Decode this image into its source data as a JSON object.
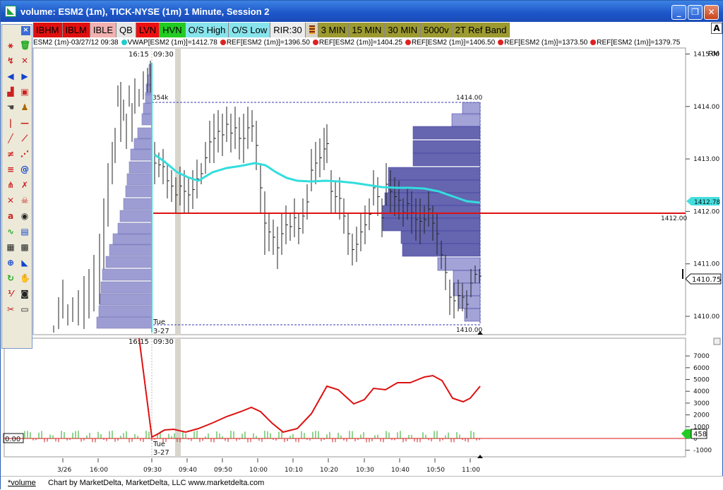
{
  "window": {
    "title": "volume: ESM2 (1m), TICK-NYSE (1m) 1 Minute, Session 2",
    "minimize_label": "_",
    "restore_label": "❐",
    "close_label": "✕"
  },
  "toolbar": {
    "buttons": [
      {
        "label": "IBHM",
        "bg": "#e01010",
        "fg": "#000000"
      },
      {
        "label": "IBLM",
        "bg": "#e01010",
        "fg": "#000000"
      },
      {
        "label": "IBLE",
        "bg": "#f2b0b0",
        "fg": "#000000"
      },
      {
        "label": "QB",
        "bg": "#e6e6e6",
        "fg": "#000000"
      },
      {
        "label": "LVN",
        "bg": "#ee1010",
        "fg": "#000000"
      },
      {
        "label": "HVN",
        "bg": "#22cc22",
        "fg": "#000000"
      },
      {
        "label": "O/S High",
        "bg": "#88e4ec",
        "fg": "#000000"
      },
      {
        "label": "O/S Low",
        "bg": "#88e4ec",
        "fg": "#000000"
      },
      {
        "label": "RIR:30",
        "bg": "#ececec",
        "fg": "#000000"
      },
      {
        "label": "3 MIN",
        "bg": "#9c9a30",
        "fg": "#000000"
      },
      {
        "label": "15 MIN",
        "bg": "#9c9a30",
        "fg": "#000000"
      },
      {
        "label": "30 MIN",
        "bg": "#9c9a30",
        "fg": "#000000"
      },
      {
        "label": "5000v",
        "bg": "#9c9a30",
        "fg": "#000000"
      },
      {
        "label": "2T Ref Band",
        "bg": "#9c9a30",
        "fg": "#000000"
      }
    ],
    "a_label": "A"
  },
  "legend": [
    {
      "text": "ESM2 (1m)-03/27/12 09:38",
      "dot": ""
    },
    {
      "text": "VWAP[ESM2 (1m)]=1412.78",
      "dot": "cyan"
    },
    {
      "text": "REF[ESM2 (1m)]=1396.50",
      "dot": "red"
    },
    {
      "text": "REF[ESM2 (1m)]=1404.25",
      "dot": "red"
    },
    {
      "text": "REF[ESM2 (1m)]=1406.50",
      "dot": "red"
    },
    {
      "text": "REF[ESM2 (1m)]=1373.50",
      "dot": "red"
    },
    {
      "text": "REF[ESM2 (1m)]=1379.75",
      "dot": "red"
    }
  ],
  "price_pane": {
    "rm_label": "RM",
    "session_labels": {
      "prev_close": "16:15",
      "open": "09:30",
      "day": "Tue",
      "date": "3-27"
    },
    "volume_label": "354k",
    "range_high_label": "1414.00",
    "range_low_label": "1410.00",
    "ref_line_label": "1412.00",
    "vwap_tag": "1412.78",
    "last_price_tag": "1410.75",
    "price_axis": [
      "1415.00",
      "1414.00",
      "1413.00",
      "1412.00",
      "1411.00",
      "1410.00"
    ]
  },
  "tick_pane": {
    "session_labels": {
      "prev_close": "16:15",
      "open": "09:30",
      "day": "Tue",
      "date": "3-27"
    },
    "zero_label": "0.00",
    "last_tag": "458",
    "axis": [
      "7000",
      "6000",
      "5000",
      "4000",
      "3000",
      "2000",
      "1000",
      "0",
      "-1000"
    ]
  },
  "time_axis": [
    "3/26",
    "16:00",
    "09:30",
    "09:40",
    "09:50",
    "10:00",
    "10:10",
    "10:20",
    "10:30",
    "10:40",
    "10:50",
    "11:00"
  ],
  "status": {
    "tab_label": "*volume",
    "credit": "Chart by MarketDelta, MarketDelta, LLC www.marketdelta.com"
  },
  "palette_icons": [
    "xyz-zoom-icon",
    "trash-icon",
    "xyz-cursor-icon",
    "xyz-arrow-icon",
    "left-arrow-icon",
    "right-arrow-icon",
    "chart-bars-icon",
    "chart-window-icon",
    "hand-cursor-icon",
    "bell-icon",
    "vertical-line-icon",
    "horizontal-line-icon",
    "trendline-icon",
    "ray-icon",
    "parallel-lines-icon",
    "fan-icon",
    "fibonacci-icon",
    "spiral-icon",
    "andrews-pitchfork-icon",
    "gann-icon",
    "cross-icon",
    "skull-icon",
    "text-a-icon",
    "circle-square-icon",
    "wave-icon",
    "ibm-icon",
    "notes-icon",
    "grid-icon",
    "zoom-icon",
    "speaker-icon",
    "refresh-icon",
    "hand-grab-icon",
    "ratio-icon",
    "camera-icon",
    "scissor-icon",
    "printer-icon"
  ],
  "colors": {
    "vwap": "#33dddd",
    "profile": "#3a3a9e",
    "ref_line": "#dd1111",
    "tick_line": "#dd1111"
  }
}
